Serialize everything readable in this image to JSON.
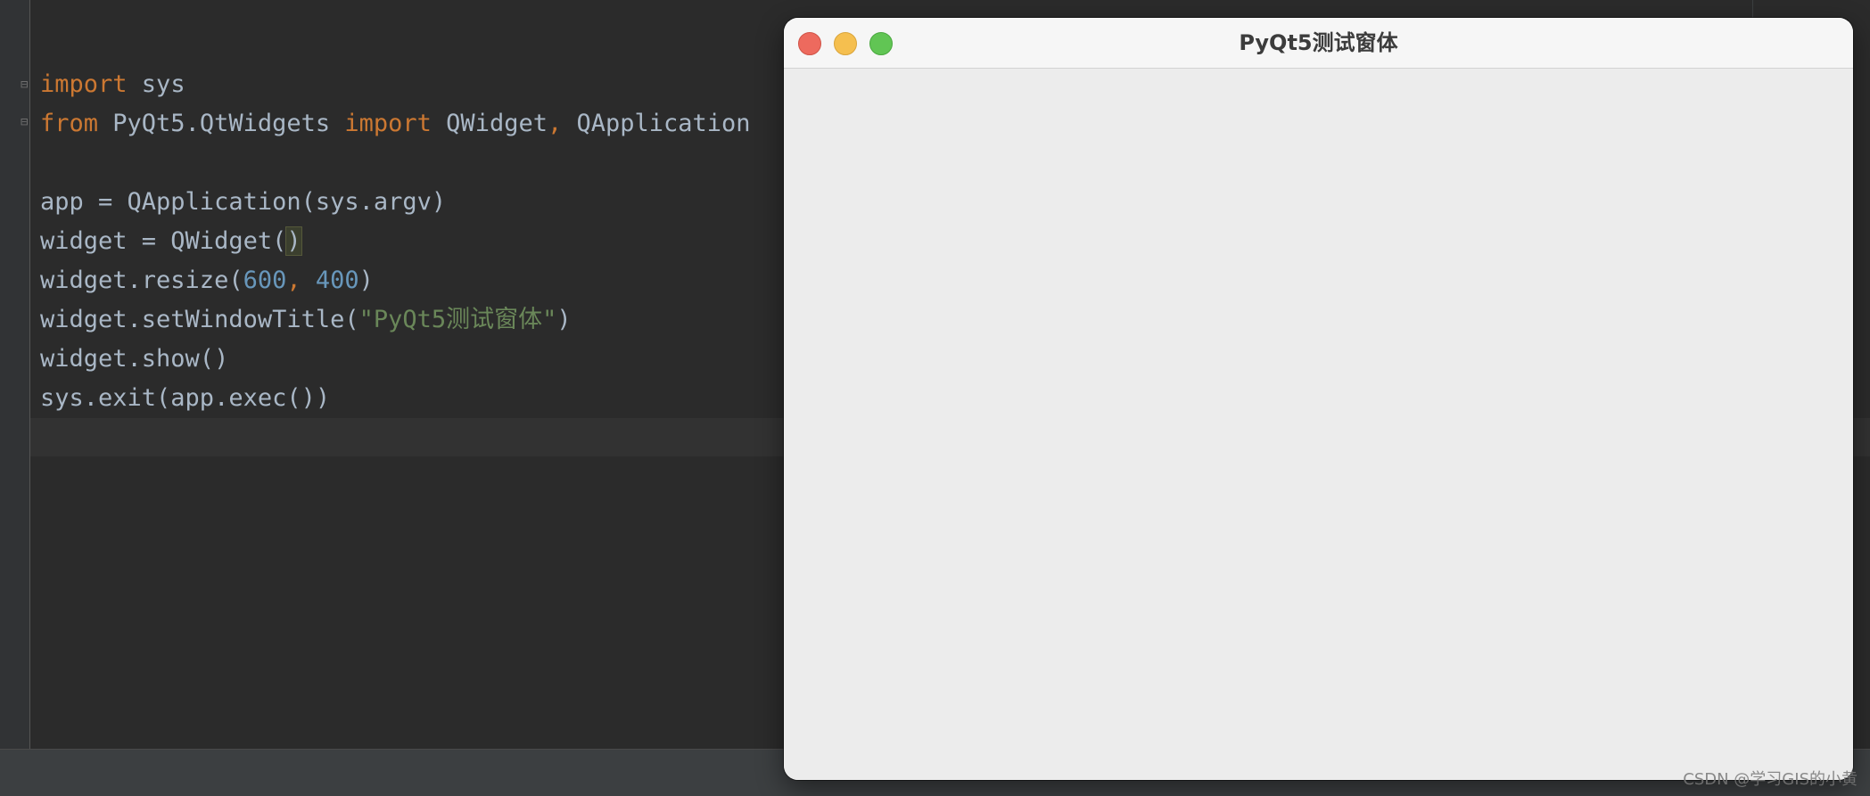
{
  "editor": {
    "lines": [
      {
        "id": "line-1",
        "tokens": [
          {
            "t": "import",
            "c": "kw"
          },
          {
            "t": " sys",
            "c": ""
          }
        ]
      },
      {
        "id": "line-2",
        "tokens": [
          {
            "t": "from",
            "c": "kw"
          },
          {
            "t": " PyQt5.QtWidgets ",
            "c": ""
          },
          {
            "t": "import",
            "c": "kw"
          },
          {
            "t": " QWidget",
            "c": ""
          },
          {
            "t": ",",
            "c": "kw"
          },
          {
            "t": " QApplication",
            "c": ""
          }
        ]
      },
      {
        "id": "line-3",
        "tokens": []
      },
      {
        "id": "line-4",
        "tokens": [
          {
            "t": "app = QApplication(sys.argv)",
            "c": ""
          }
        ]
      },
      {
        "id": "line-5",
        "tokens": [
          {
            "t": "widget = QWidget(",
            "c": ""
          },
          {
            "t": ")",
            "c": "brace-hl"
          }
        ]
      },
      {
        "id": "line-6",
        "tokens": [
          {
            "t": "widget.resize(",
            "c": ""
          },
          {
            "t": "600",
            "c": "num"
          },
          {
            "t": ", ",
            "c": "kw"
          },
          {
            "t": "400",
            "c": "num"
          },
          {
            "t": ")",
            "c": ""
          }
        ]
      },
      {
        "id": "line-7",
        "tokens": [
          {
            "t": "widget.setWindowTitle(",
            "c": ""
          },
          {
            "t": "\"PyQt5测试窗体\"",
            "c": "str"
          },
          {
            "t": ")",
            "c": ""
          }
        ]
      },
      {
        "id": "line-8",
        "tokens": [
          {
            "t": "widget.show()",
            "c": ""
          }
        ]
      },
      {
        "id": "line-9",
        "tokens": [
          {
            "t": "sys.exit(app.exec())",
            "c": ""
          }
        ]
      }
    ]
  },
  "window": {
    "title": "PyQt5测试窗体"
  },
  "watermark": "CSDN @学习GIS的小黄",
  "colors": {
    "keyword": "#cc7832",
    "number": "#6897bb",
    "string": "#6a8759",
    "text": "#a9b7c6",
    "background": "#2b2b2b"
  }
}
